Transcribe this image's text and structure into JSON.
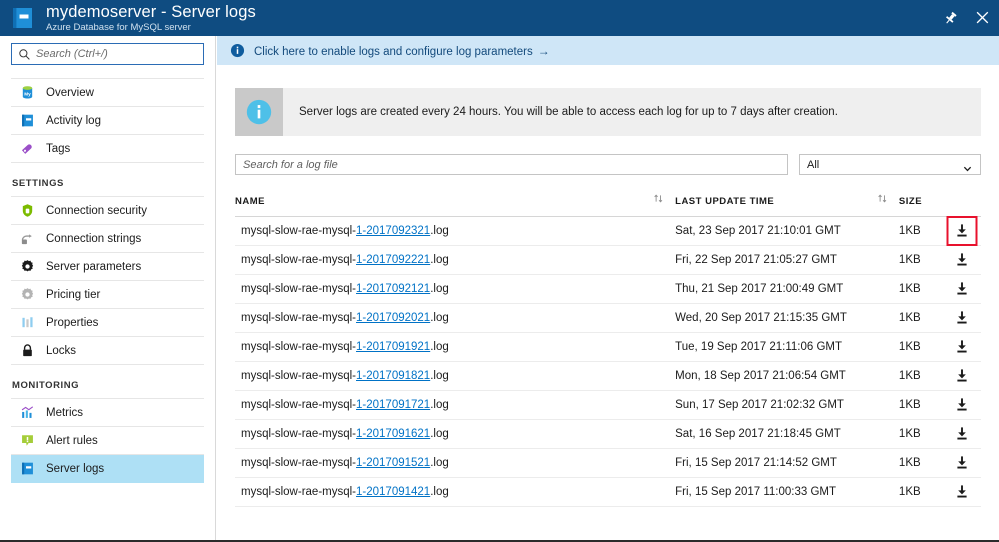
{
  "titlebar": {
    "icon": "book-icon",
    "title": "mydemoserver - Server logs",
    "subtitle": "Azure Database for MySQL server",
    "pin_label": "✐",
    "close_label": "✕"
  },
  "sidebar": {
    "search": {
      "placeholder": "Search (Ctrl+/)",
      "value": "",
      "icon": "search-icon"
    },
    "items": [
      {
        "label": "Overview",
        "icon": "mysql-database-icon",
        "selected": false
      },
      {
        "label": "Activity log",
        "icon": "activity-log-book-icon",
        "selected": false
      },
      {
        "label": "Tags",
        "icon": "tag-icon",
        "selected": false
      }
    ],
    "settings_header": "SETTINGS",
    "settings_items": [
      {
        "label": "Connection security",
        "icon": "shield-icon",
        "selected": false
      },
      {
        "label": "Connection strings",
        "icon": "plug-connector-icon",
        "selected": false
      },
      {
        "label": "Server parameters",
        "icon": "gear-icon",
        "selected": false
      },
      {
        "label": "Pricing tier",
        "icon": "gear-light-icon",
        "selected": false
      },
      {
        "label": "Properties",
        "icon": "bars-icon",
        "selected": false
      },
      {
        "label": "Locks",
        "icon": "lock-icon",
        "selected": false
      }
    ],
    "monitoring_header": "MONITORING",
    "monitoring_items": [
      {
        "label": "Metrics",
        "icon": "chart-icon",
        "selected": false
      },
      {
        "label": "Alert rules",
        "icon": "alert-bubble-icon",
        "selected": false
      },
      {
        "label": "Server logs",
        "icon": "server-logs-book-icon",
        "selected": true
      }
    ]
  },
  "main": {
    "infobar": {
      "icon": "info-circle-icon",
      "text": "Click here to enable logs and configure log parameters",
      "arrow": "→"
    },
    "notice": {
      "icon": "info-circle-large-icon",
      "text": "Server logs are created every 24 hours. You will be able to access each log for up to 7 days after creation."
    },
    "filters": {
      "search_placeholder": "Search for a log file",
      "search_value": "",
      "select_value": "All"
    },
    "table": {
      "headers": {
        "name": "NAME",
        "last_update_time": "LAST UPDATE TIME",
        "size": "SIZE"
      },
      "rows": [
        {
          "name_prefix": "mysql-slow-rae-mysql-",
          "name_link": "1-2017092321",
          "name_suffix": ".log",
          "time": "Sat, 23 Sep 2017 21:10:01 GMT",
          "size": "1KB",
          "download_icon": "download-icon",
          "highlighted": true
        },
        {
          "name_prefix": "mysql-slow-rae-mysql-",
          "name_link": "1-2017092221",
          "name_suffix": ".log",
          "time": "Fri, 22 Sep 2017 21:05:27 GMT",
          "size": "1KB",
          "download_icon": "download-icon",
          "highlighted": false
        },
        {
          "name_prefix": "mysql-slow-rae-mysql-",
          "name_link": "1-2017092121",
          "name_suffix": ".log",
          "time": "Thu, 21 Sep 2017 21:00:49 GMT",
          "size": "1KB",
          "download_icon": "download-icon",
          "highlighted": false
        },
        {
          "name_prefix": "mysql-slow-rae-mysql-",
          "name_link": "1-2017092021",
          "name_suffix": ".log",
          "time": "Wed, 20 Sep 2017 21:15:35 GMT",
          "size": "1KB",
          "download_icon": "download-icon",
          "highlighted": false
        },
        {
          "name_prefix": "mysql-slow-rae-mysql-",
          "name_link": "1-2017091921",
          "name_suffix": ".log",
          "time": "Tue, 19 Sep 2017 21:11:06 GMT",
          "size": "1KB",
          "download_icon": "download-icon",
          "highlighted": false
        },
        {
          "name_prefix": "mysql-slow-rae-mysql-",
          "name_link": "1-2017091821",
          "name_suffix": ".log",
          "time": "Mon, 18 Sep 2017 21:06:54 GMT",
          "size": "1KB",
          "download_icon": "download-icon",
          "highlighted": false
        },
        {
          "name_prefix": "mysql-slow-rae-mysql-",
          "name_link": "1-2017091721",
          "name_suffix": ".log",
          "time": "Sun, 17 Sep 2017 21:02:32 GMT",
          "size": "1KB",
          "download_icon": "download-icon",
          "highlighted": false
        },
        {
          "name_prefix": "mysql-slow-rae-mysql-",
          "name_link": "1-2017091621",
          "name_suffix": ".log",
          "time": "Sat, 16 Sep 2017 21:18:45 GMT",
          "size": "1KB",
          "download_icon": "download-icon",
          "highlighted": false
        },
        {
          "name_prefix": "mysql-slow-rae-mysql-",
          "name_link": "1-2017091521",
          "name_suffix": ".log",
          "time": "Fri, 15 Sep 2017 21:14:52 GMT",
          "size": "1KB",
          "download_icon": "download-icon",
          "highlighted": false
        },
        {
          "name_prefix": "mysql-slow-rae-mysql-",
          "name_link": "1-2017091421",
          "name_suffix": ".log",
          "time": "Fri, 15 Sep 2017 11:00:33 GMT",
          "size": "1KB",
          "download_icon": "download-icon",
          "highlighted": false
        }
      ]
    }
  },
  "colors": {
    "header_blue": "#0f4c81",
    "infobar_blue": "#cfe6f7",
    "selected_blue": "#aee0f5",
    "link_blue": "#0072c6",
    "highlight_red": "#e8112d"
  }
}
